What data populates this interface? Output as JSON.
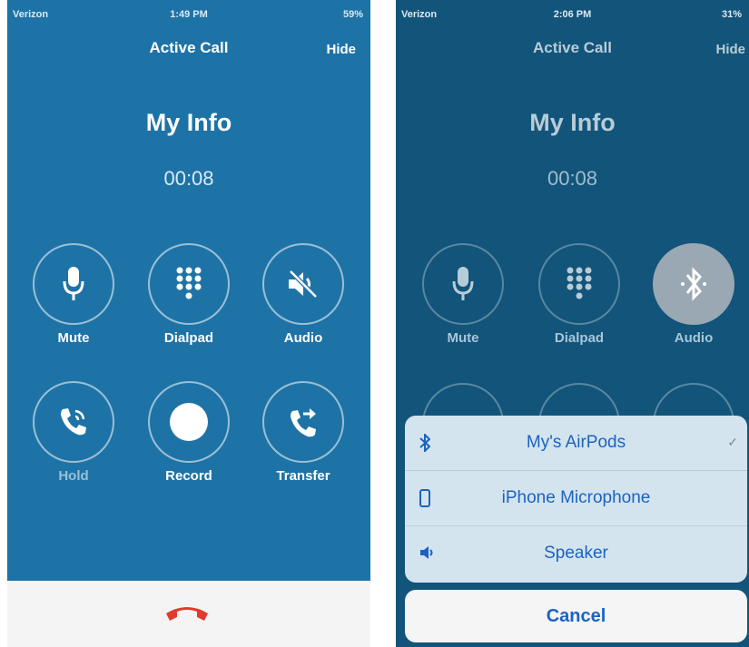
{
  "phone_a": {
    "status": {
      "carrier": "Verizon",
      "time": "1:49 PM",
      "battery": "59%"
    },
    "nav": {
      "title": "Active Call",
      "hide": "Hide"
    },
    "caller": "My Info",
    "timer": "00:08",
    "buttons": [
      {
        "label": "Mute",
        "icon": "microphone-icon"
      },
      {
        "label": "Dialpad",
        "icon": "dialpad-icon"
      },
      {
        "label": "Audio",
        "icon": "speaker-muted-icon"
      },
      {
        "label": "Hold",
        "icon": "hold-icon"
      },
      {
        "label": "Record",
        "icon": "record-icon"
      },
      {
        "label": "Transfer",
        "icon": "transfer-icon"
      }
    ],
    "end_call_color": "#e23b2e"
  },
  "phone_b": {
    "status": {
      "carrier": "Verizon",
      "time": "2:06 PM",
      "battery": "31%"
    },
    "nav": {
      "title": "Active Call",
      "hide": "Hide"
    },
    "caller": "My Info",
    "timer": "00:08",
    "buttons": [
      {
        "label": "Mute",
        "icon": "microphone-icon"
      },
      {
        "label": "Dialpad",
        "icon": "dialpad-icon"
      },
      {
        "label": "Audio",
        "icon": "bluetooth-icon"
      }
    ],
    "audio_options": [
      {
        "label": "My's AirPods",
        "icon": "bluetooth-icon",
        "selected": true,
        "check": "✓"
      },
      {
        "label": "iPhone Microphone",
        "icon": "iphone-icon"
      },
      {
        "label": "Speaker",
        "icon": "speaker-icon"
      }
    ],
    "cancel": "Cancel"
  }
}
